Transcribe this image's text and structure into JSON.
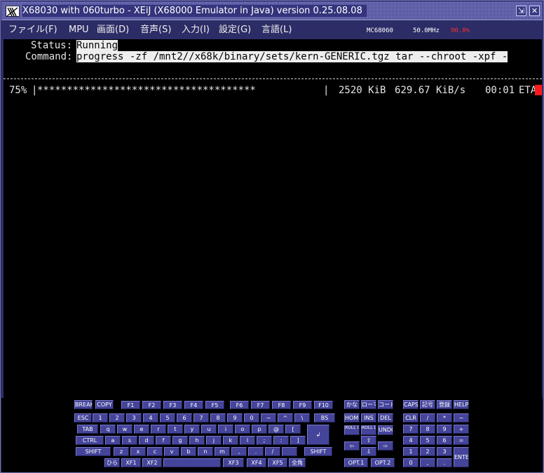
{
  "window": {
    "title": "X68030 with 060turbo - XEiJ (X68000 Emulator in Java) version 0.25.08.08",
    "restore_glyph": "⇲",
    "close_glyph": "✕"
  },
  "menu": {
    "items": [
      {
        "label": "ファイル(F)"
      },
      {
        "label": "MPU"
      },
      {
        "label": "画面(D)"
      },
      {
        "label": "音声(S)"
      },
      {
        "label": "入力(I)"
      },
      {
        "label": "設定(G)"
      },
      {
        "label": "言語(L)"
      }
    ],
    "cpu": "MC68060",
    "clock": "50.0MHz",
    "load": "90.0%",
    "load_color": "#ff3030"
  },
  "terminal": {
    "status_label": "Status:",
    "status_value": "Running",
    "command_label": "Command:",
    "command_value": "progress -zf /mnt2//x68k/binary/sets/kern-GENERIC.tgz tar --chroot -xpf -",
    "percent": "75%",
    "bar_start": "|",
    "bar_fill": "*************************************",
    "bar_end": "|",
    "size": "2520 KiB",
    "rate": "629.67 KiB/s",
    "time": "00:01",
    "eta": "ETA",
    "progress": 0.75,
    "cursor_color": "#ff1a1a"
  },
  "keyboard": {
    "keys": [
      {
        "id": "break",
        "label": "BREAK"
      },
      {
        "id": "copy",
        "label": "COPY"
      },
      {
        "id": "f1",
        "label": "F1"
      },
      {
        "id": "f2",
        "label": "F2"
      },
      {
        "id": "f3",
        "label": "F3"
      },
      {
        "id": "f4",
        "label": "F4"
      },
      {
        "id": "f5",
        "label": "F5"
      },
      {
        "id": "f6",
        "label": "F6"
      },
      {
        "id": "f7",
        "label": "F7"
      },
      {
        "id": "f8",
        "label": "F8"
      },
      {
        "id": "f9",
        "label": "F9"
      },
      {
        "id": "f10",
        "label": "F10"
      },
      {
        "id": "kana",
        "label": "かな"
      },
      {
        "id": "romaji",
        "label": "ローマ"
      },
      {
        "id": "code",
        "label": "コード"
      },
      {
        "id": "caps",
        "label": "CAPS"
      },
      {
        "id": "kigo",
        "label": "記号"
      },
      {
        "id": "toroku",
        "label": "登録"
      },
      {
        "id": "help",
        "label": "HELP"
      },
      {
        "id": "esc",
        "label": "ESC"
      },
      {
        "id": "k1",
        "label": "1"
      },
      {
        "id": "k2",
        "label": "2"
      },
      {
        "id": "k3",
        "label": "3"
      },
      {
        "id": "k4",
        "label": "4"
      },
      {
        "id": "k5",
        "label": "5"
      },
      {
        "id": "k6",
        "label": "6"
      },
      {
        "id": "k7",
        "label": "7"
      },
      {
        "id": "k8",
        "label": "8"
      },
      {
        "id": "k9",
        "label": "9"
      },
      {
        "id": "k0",
        "label": "0"
      },
      {
        "id": "minus",
        "label": "−"
      },
      {
        "id": "caret",
        "label": "^"
      },
      {
        "id": "yen",
        "label": "\\"
      },
      {
        "id": "bs",
        "label": "BS"
      },
      {
        "id": "home",
        "label": "HOME"
      },
      {
        "id": "ins",
        "label": "INS"
      },
      {
        "id": "del",
        "label": "DEL"
      },
      {
        "id": "clr",
        "label": "CLR"
      },
      {
        "id": "nslash",
        "label": "/"
      },
      {
        "id": "nstar",
        "label": "*"
      },
      {
        "id": "nminus",
        "label": "−"
      },
      {
        "id": "tab",
        "label": "TAB"
      },
      {
        "id": "q",
        "label": "q"
      },
      {
        "id": "w",
        "label": "w"
      },
      {
        "id": "e",
        "label": "e"
      },
      {
        "id": "r",
        "label": "r"
      },
      {
        "id": "t",
        "label": "t"
      },
      {
        "id": "y",
        "label": "y"
      },
      {
        "id": "u",
        "label": "u"
      },
      {
        "id": "i",
        "label": "i"
      },
      {
        "id": "o",
        "label": "o"
      },
      {
        "id": "p",
        "label": "p"
      },
      {
        "id": "at",
        "label": "@"
      },
      {
        "id": "lbr",
        "label": "["
      },
      {
        "id": "ret",
        "label": "↲"
      },
      {
        "id": "rollup",
        "label": "ROLL UP"
      },
      {
        "id": "rolldown",
        "label": "ROLL DOWN"
      },
      {
        "id": "undo",
        "label": "UNDO"
      },
      {
        "id": "n7",
        "label": "7"
      },
      {
        "id": "n8",
        "label": "8"
      },
      {
        "id": "n9",
        "label": "9"
      },
      {
        "id": "nplus",
        "label": "+"
      },
      {
        "id": "ctrl",
        "label": "CTRL"
      },
      {
        "id": "a",
        "label": "a"
      },
      {
        "id": "s",
        "label": "s"
      },
      {
        "id": "d",
        "label": "d"
      },
      {
        "id": "f",
        "label": "f"
      },
      {
        "id": "g",
        "label": "g"
      },
      {
        "id": "h",
        "label": "h"
      },
      {
        "id": "j",
        "label": "j"
      },
      {
        "id": "k",
        "label": "k"
      },
      {
        "id": "l",
        "label": "l"
      },
      {
        "id": "semi",
        "label": ";"
      },
      {
        "id": "colon",
        "label": ":"
      },
      {
        "id": "rbr",
        "label": "]"
      },
      {
        "id": "up",
        "label": "⇧"
      },
      {
        "id": "n4",
        "label": "4"
      },
      {
        "id": "n5",
        "label": "5"
      },
      {
        "id": "n6",
        "label": "6"
      },
      {
        "id": "neq",
        "label": "="
      },
      {
        "id": "lshift",
        "label": "SHIFT"
      },
      {
        "id": "z",
        "label": "z"
      },
      {
        "id": "x",
        "label": "x"
      },
      {
        "id": "c",
        "label": "c"
      },
      {
        "id": "v",
        "label": "v"
      },
      {
        "id": "b",
        "label": "b"
      },
      {
        "id": "n",
        "label": "n"
      },
      {
        "id": "m",
        "label": "m"
      },
      {
        "id": "comma",
        "label": ","
      },
      {
        "id": "period",
        "label": "."
      },
      {
        "id": "slash",
        "label": "/"
      },
      {
        "id": "underscore",
        "label": ""
      },
      {
        "id": "rshift",
        "label": "SHIFT"
      },
      {
        "id": "left",
        "label": "⇦"
      },
      {
        "id": "right",
        "label": "⇨"
      },
      {
        "id": "down",
        "label": "⇩"
      },
      {
        "id": "n1",
        "label": "1"
      },
      {
        "id": "n2",
        "label": "2"
      },
      {
        "id": "n3",
        "label": "3"
      },
      {
        "id": "enter",
        "label": "ENTER"
      },
      {
        "id": "hira",
        "label": "ひら"
      },
      {
        "id": "xf1",
        "label": "XF1"
      },
      {
        "id": "xf2",
        "label": "XF2"
      },
      {
        "id": "space",
        "label": ""
      },
      {
        "id": "xf3",
        "label": "XF3"
      },
      {
        "id": "xf4",
        "label": "XF4"
      },
      {
        "id": "xf5",
        "label": "XF5"
      },
      {
        "id": "zenkaku",
        "label": "全角"
      },
      {
        "id": "opt1",
        "label": "OPT.1"
      },
      {
        "id": "opt2",
        "label": "OPT.2"
      },
      {
        "id": "n0",
        "label": "0"
      },
      {
        "id": "ncomma",
        "label": ","
      },
      {
        "id": "nperiod",
        "label": "."
      }
    ]
  }
}
